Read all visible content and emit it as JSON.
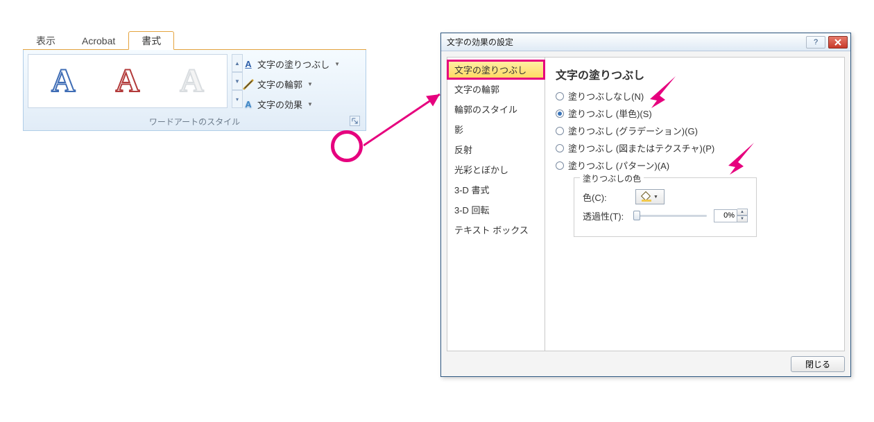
{
  "ribbon": {
    "tabs": {
      "view": "表示",
      "acrobat": "Acrobat",
      "format": "書式"
    },
    "cmds": {
      "fill": "文字の塗りつぶし",
      "outline": "文字の輪郭",
      "effects": "文字の効果"
    },
    "group_label": "ワードアートのスタイル"
  },
  "dialog": {
    "title": "文字の効果の設定",
    "side": {
      "fill": "文字の塗りつぶし",
      "outline": "文字の輪郭",
      "outline_style": "輪郭のスタイル",
      "shadow": "影",
      "reflection": "反射",
      "glow": "光彩とぼかし",
      "d3_format": "3-D 書式",
      "d3_rotation": "3-D 回転",
      "textbox": "テキスト ボックス"
    },
    "main": {
      "heading": "文字の塗りつぶし",
      "none": "塗りつぶしなし(N)",
      "solid": "塗りつぶし (単色)(S)",
      "gradient": "塗りつぶし (グラデーション)(G)",
      "picture": "塗りつぶし (図またはテクスチャ)(P)",
      "pattern": "塗りつぶし (パターン)(A)",
      "fill_color_legend": "塗りつぶしの色",
      "color_label": "色(C):",
      "transparency_label": "透過性(T):",
      "transparency_value": "0%"
    },
    "close": "閉じる"
  }
}
